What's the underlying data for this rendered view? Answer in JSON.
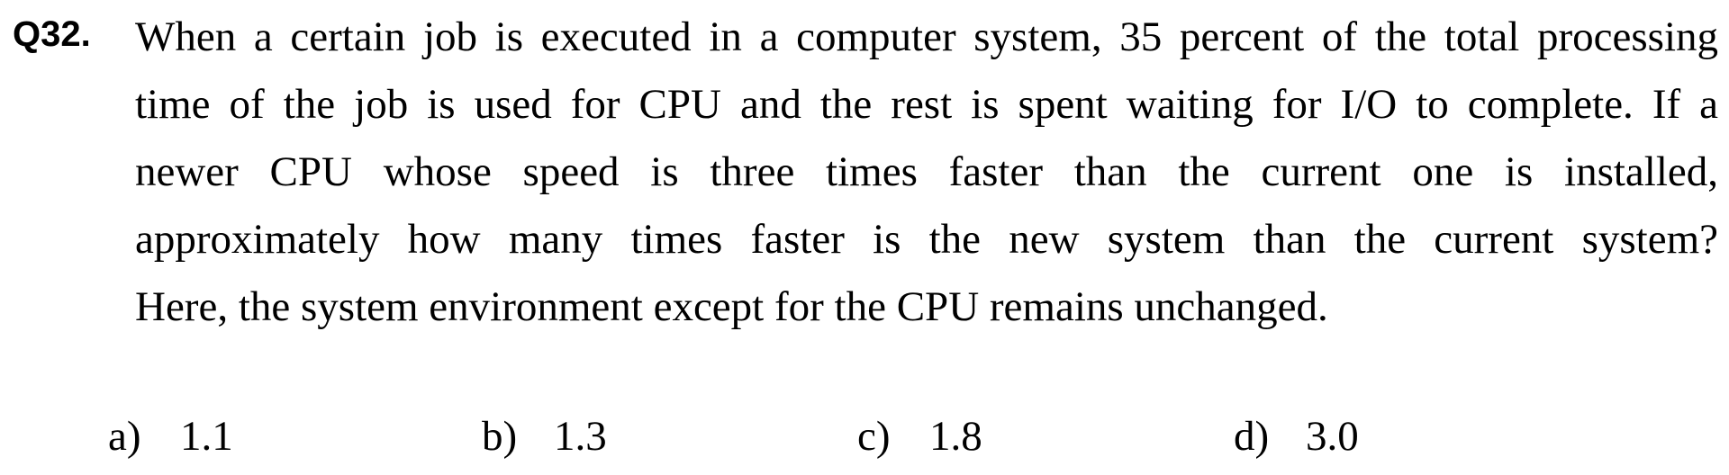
{
  "question": {
    "number": "Q32.",
    "lines": [
      "When a certain job is executed in a computer system, 35 percent of the total processing",
      "time of the job is used for CPU and the rest is spent waiting for I/O to complete.   If a",
      "newer CPU whose speed is three times faster than the current one is installed,",
      "approximately how many times faster is the new system than the current system?",
      "Here, the system environment except for the CPU remains unchanged."
    ]
  },
  "options": [
    {
      "letter": "a)",
      "value": "1.1"
    },
    {
      "letter": "b)",
      "value": "1.3"
    },
    {
      "letter": "c)",
      "value": "1.8"
    },
    {
      "letter": "d)",
      "value": "3.0"
    }
  ]
}
